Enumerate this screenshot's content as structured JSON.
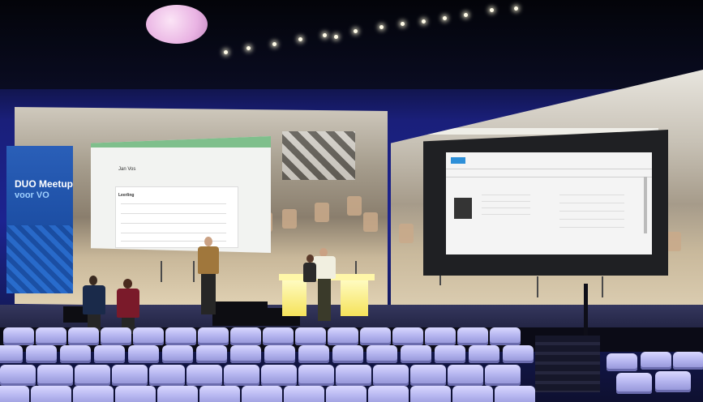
{
  "banner": {
    "small_text": "",
    "title": "DUO Meetup",
    "subtitle": "voor VO"
  },
  "screen_left": {
    "header_text": "",
    "name": "Jan Vos",
    "section_heading": "Leerling"
  },
  "screen_right": {
    "button_label": ""
  },
  "colors": {
    "banner_blue": "#1c4ea4",
    "backdrop_blue": "#1c2390",
    "seat_lavender": "#b6b6f0",
    "desk_yellow": "#f5e25a",
    "screen_header_green": "#7fbf8c"
  }
}
